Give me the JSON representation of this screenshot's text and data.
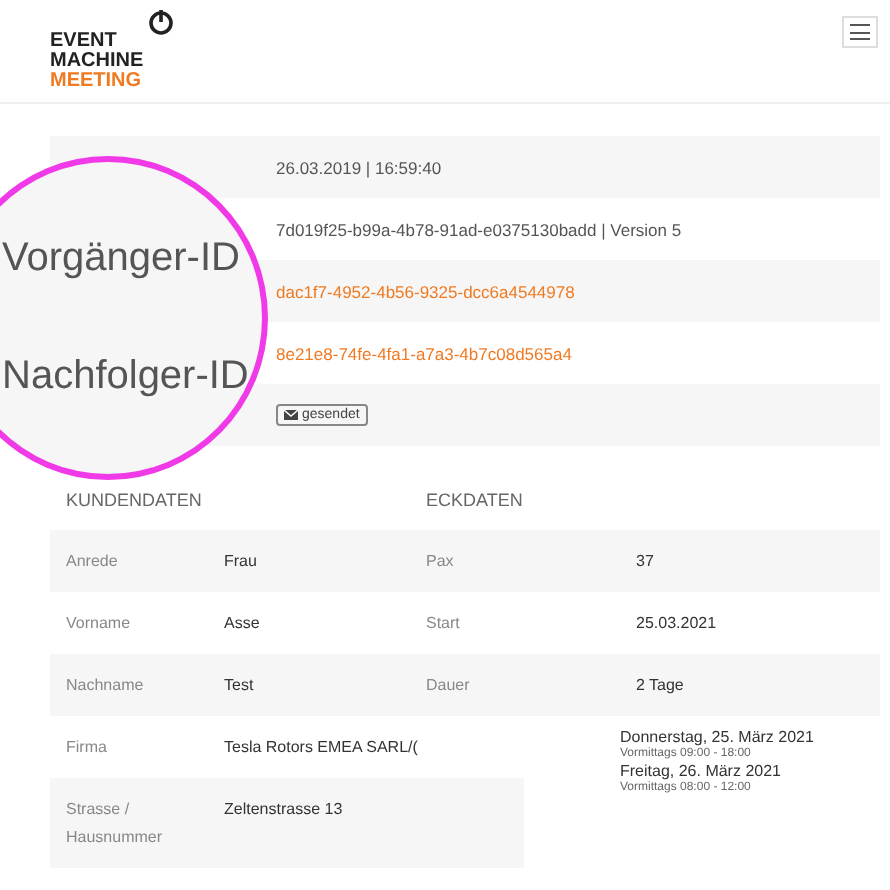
{
  "logo": {
    "lines": [
      "EVENT",
      "MACHINE"
    ],
    "accent": "MEETING"
  },
  "meta_rows": [
    {
      "kind": "text",
      "value": "26.03.2019 | 16:59:40"
    },
    {
      "kind": "text",
      "value": "7d019f25-b99a-4b78-91ad-e0375130badd | Version 5"
    },
    {
      "kind": "link",
      "value": "dac1f7-4952-4b56-9325-dcc6a4544978"
    },
    {
      "kind": "link",
      "value": "8e21e8-74fe-4fa1-a7a3-4b7c08d565a4"
    },
    {
      "kind": "badge",
      "value": "gesendet"
    }
  ],
  "magnifier": {
    "labels": [
      "Vorgänger-ID",
      "Nachfolger-ID"
    ]
  },
  "customer": {
    "title": "KUNDENDATEN"
  },
  "key_data": {
    "title": "ECKDATEN"
  },
  "rows": [
    {
      "label": "Anrede",
      "value": "Frau",
      "key_label": "Pax",
      "key_value": "37"
    },
    {
      "label": "Vorname",
      "value": "Asse",
      "key_label": "Start",
      "key_value": "25.03.2021"
    },
    {
      "label": "Nachname",
      "value": "Test",
      "key_label": "Dauer",
      "key_value": "2 Tage"
    }
  ],
  "more_rows": [
    {
      "label": "Firma",
      "value": "Tesla Rotors EMEA SARL/("
    },
    {
      "label": "Strasse / Hausnummer",
      "value": "Zeltenstrasse 13"
    }
  ],
  "schedule": [
    {
      "day": "Donnerstag, 25. März 2021",
      "time": "Vormittags 09:00 - 18:00"
    },
    {
      "day": "Freitag, 26. März 2021",
      "time": "Vormittags 08:00 - 12:00"
    }
  ]
}
